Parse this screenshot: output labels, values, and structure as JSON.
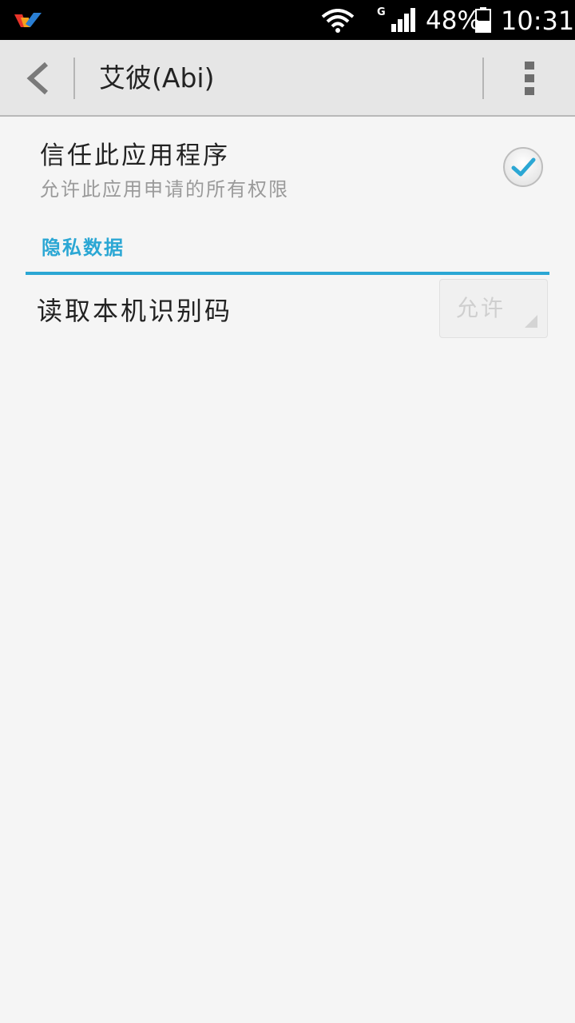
{
  "status_bar": {
    "network_type": "G",
    "battery_percent": "48%",
    "time": "10:31",
    "icons": [
      "app-logo-icon",
      "wifi-icon",
      "signal-icon",
      "battery-icon"
    ]
  },
  "action_bar": {
    "title": "艾彼(Abi)",
    "icons": [
      "back-arrow-icon",
      "overflow-menu-icon"
    ]
  },
  "trust": {
    "title": "信任此应用程序",
    "subtitle": "允许此应用申请的所有权限",
    "checked": true
  },
  "section": {
    "title": "隐私数据",
    "accent_color": "#2ba7d4"
  },
  "permissions": [
    {
      "label": "读取本机识别码",
      "value": "允许",
      "enabled": false
    }
  ]
}
